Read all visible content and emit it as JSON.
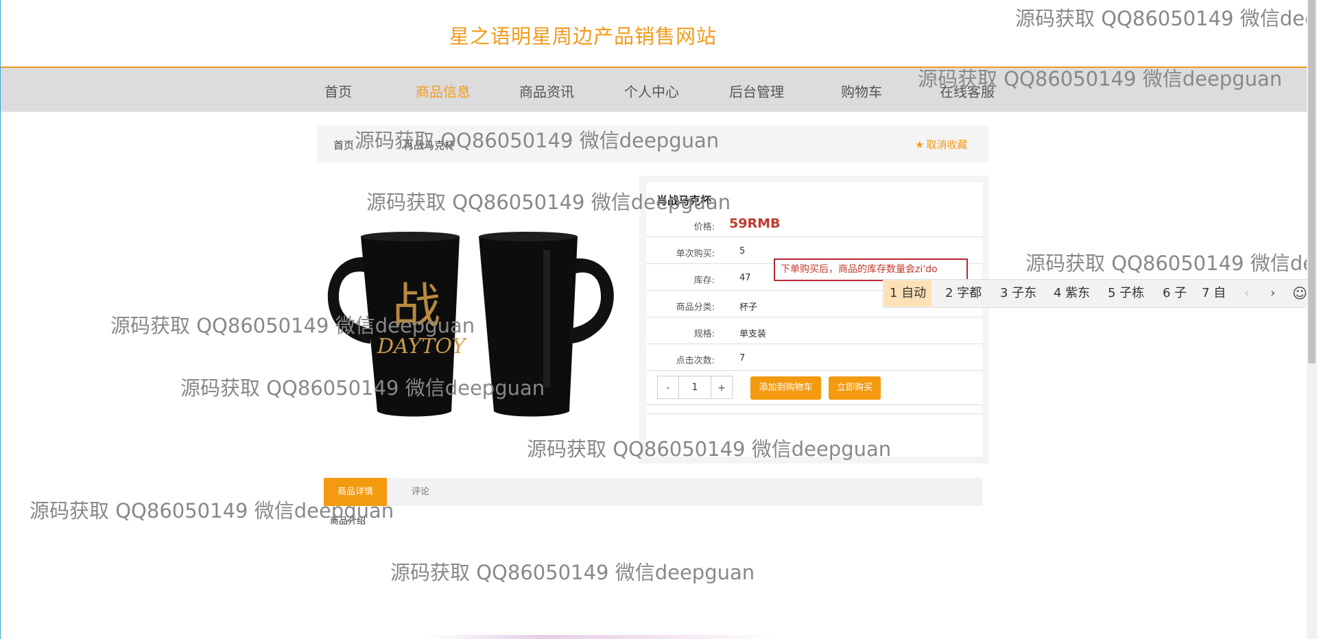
{
  "site": {
    "title": "星之语明星周边产品销售网站"
  },
  "nav": {
    "items": [
      {
        "label": "首页",
        "active": false
      },
      {
        "label": "商品信息",
        "active": true
      },
      {
        "label": "商品资讯",
        "active": false
      },
      {
        "label": "个人中心",
        "active": false
      },
      {
        "label": "后台管理",
        "active": false
      },
      {
        "label": "购物车",
        "active": false
      },
      {
        "label": "在线客服",
        "active": false
      }
    ]
  },
  "breadcrumb": {
    "home": "首页",
    "current": "肖战马克杯",
    "unfavorite": "取消收藏"
  },
  "product": {
    "name": "肖战马克杯",
    "image_alt": "mug",
    "image_text": "DAYTOY",
    "image_glyph": "战",
    "price_label": "价格:",
    "price": "59RMB",
    "rows": [
      {
        "label": "单次购买:",
        "value": "5"
      },
      {
        "label": "库存:",
        "value": "47"
      },
      {
        "label": "商品分类:",
        "value": "杯子"
      },
      {
        "label": "规格:",
        "value": "单支装"
      },
      {
        "label": "点击次数:",
        "value": "7"
      }
    ],
    "quantity": "1",
    "minus": "-",
    "plus": "+",
    "add_to_cart": "添加到购物车",
    "buy_now": "立即购买"
  },
  "ime": {
    "input_text": "下单购买后，商品的库存数量会zi'do",
    "candidates": [
      "1 自动",
      "2 字都",
      "3 子东",
      "4 紫东",
      "5 子栋",
      "6 子",
      "7 自"
    ],
    "prev": "‹",
    "next": "›",
    "emoji": "☺"
  },
  "tabs": {
    "detail": "商品详情",
    "review": "评论",
    "intro_label": "商品介绍"
  },
  "watermark": {
    "text_full": "源码获取 QQ86050149 微信deepguan",
    "text_cut_top": "源码获取 QQ86050149 微信dee",
    "text_cut_right": "源码获取 QQ86050149 微信de"
  },
  "colors": {
    "accent": "#f39a1a",
    "price": "#c0392b",
    "nav_bg": "#dcdcdc"
  }
}
